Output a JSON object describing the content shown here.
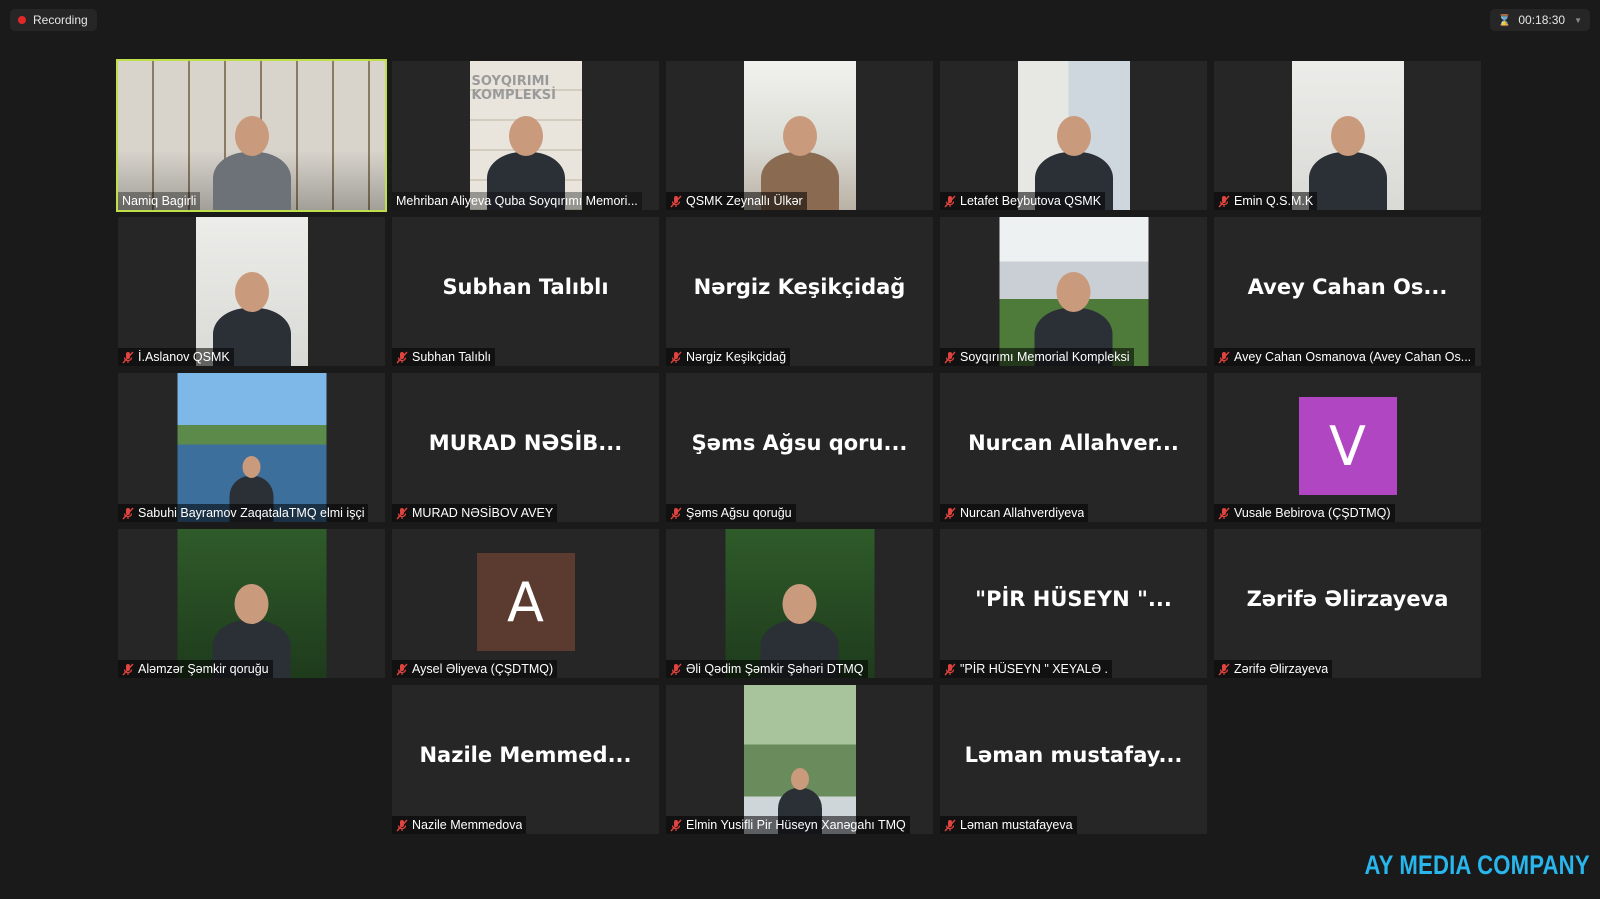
{
  "top_bar": {
    "recording_label": "Recording",
    "timer": "00:18:30"
  },
  "participants": [
    {
      "label": "Namiq Bagirli",
      "muted": false,
      "active": true,
      "video": "self"
    },
    {
      "label": "Mehriban Aliyeva Quba Soyqırımı  Memori...",
      "muted": false,
      "video": "books",
      "background_sign": "SOYQIRIMI KOMPLEKSİ"
    },
    {
      "label": "QSMK Zeynallı Ülkər",
      "muted": true,
      "video": "wall"
    },
    {
      "label": "Letafet Beybutova QSMK",
      "muted": true,
      "video": "shelf"
    },
    {
      "label": "Emin Q.S.M.K",
      "muted": true,
      "video": "office"
    },
    {
      "label": "İ.Aslanov QSMK",
      "muted": true,
      "video": "office"
    },
    {
      "label": "Subhan Talıblı",
      "muted": true,
      "big_name": "Subhan Talıblı"
    },
    {
      "label": "Nərgiz Keşikçidağ",
      "muted": true,
      "big_name": "Nərgiz Keşikçidağ"
    },
    {
      "label": "Soyqırımı Memorial Kompleksi",
      "muted": true,
      "video": "memorial"
    },
    {
      "label": "Avey Cahan Osmanova (Avey Cahan Os...",
      "muted": true,
      "big_name": "Avey  Cahan  Os..."
    },
    {
      "label": "Sabuhi Bayramov ZaqatalaTMQ elmi işçi",
      "muted": true,
      "video": "lake"
    },
    {
      "label": "MURAD NƏSİBOV AVEY",
      "muted": true,
      "big_name": "MURAD  NƏSİB..."
    },
    {
      "label": "Şəms Ağsu qoruğu",
      "muted": true,
      "big_name": "Şəms  Ağsu  qoru..."
    },
    {
      "label": "Nurcan Allahverdiyeva",
      "muted": true,
      "big_name": "Nurcan  Allahver..."
    },
    {
      "label": "Vusale Bebirova (ÇŞDTMQ)",
      "muted": true,
      "avatar_letter": "V",
      "avatar_color": "#b146c2"
    },
    {
      "label": "Aləmzər Şəmkir qoruğu",
      "muted": true,
      "video": "green"
    },
    {
      "label": "Aysel Əliyeva (ÇŞDTMQ)",
      "muted": true,
      "avatar_letter": "A",
      "avatar_color": "#5b3a2f"
    },
    {
      "label": "Əli Qədim Şəmkir Şəhəri DTMQ",
      "muted": true,
      "video": "green"
    },
    {
      "label": "\"PİR HÜSEYN \" XEYALƏ .",
      "muted": true,
      "big_name": "\"PİR  HÜSEYN  \"..."
    },
    {
      "label": "Zərifə Əlirzayeva",
      "muted": true,
      "big_name": "Zərifə  Əlirzayeva"
    },
    {
      "label": "Nazile Memmedova",
      "muted": true,
      "big_name": "Nazile  Memmed..."
    },
    {
      "label": "Elmin Yusifli Pir Hüseyn Xanəgahı TMQ",
      "muted": true,
      "video": "garden"
    },
    {
      "label": "Ləman mustafayeva",
      "muted": true,
      "big_name": "Ləman  mustafay..."
    }
  ],
  "watermark": "AY MEDIA COMPANY"
}
